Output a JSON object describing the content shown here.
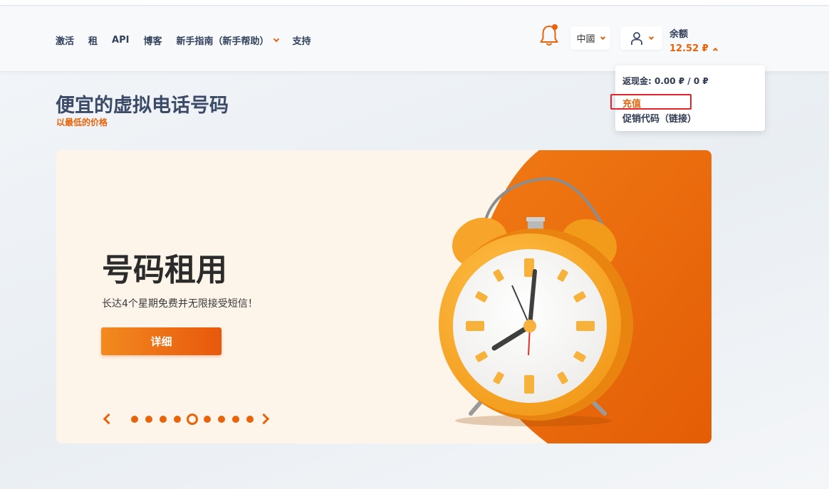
{
  "nav": {
    "activation": "激活",
    "rent": "租",
    "api": "API",
    "blog": "博客",
    "guide": "新手指南（新手帮助）",
    "support": "支持"
  },
  "header": {
    "country": "中國",
    "balance_label": "余额",
    "balance_amount": "12.52 ₽"
  },
  "dropdown": {
    "cashback": "返现金: 0.00 ₽ / 0 ₽",
    "topup": "充值",
    "promo": "促销代码（链接）"
  },
  "hero": {
    "title": "便宜的虚拟电话号码",
    "subtitle": "以最低的价格"
  },
  "banner": {
    "title": "号码租用",
    "description": "长达4个星期免费并无限接受短信！",
    "cta": "详细",
    "slide_count": 9,
    "active_slide": 5
  },
  "colors": {
    "accent": "#e8630a",
    "highlight_border": "#e3242b"
  },
  "icons": [
    "bell-icon",
    "user-icon",
    "chevron-down-icon",
    "chevron-up-icon",
    "arrow-left-icon",
    "arrow-right-icon"
  ]
}
